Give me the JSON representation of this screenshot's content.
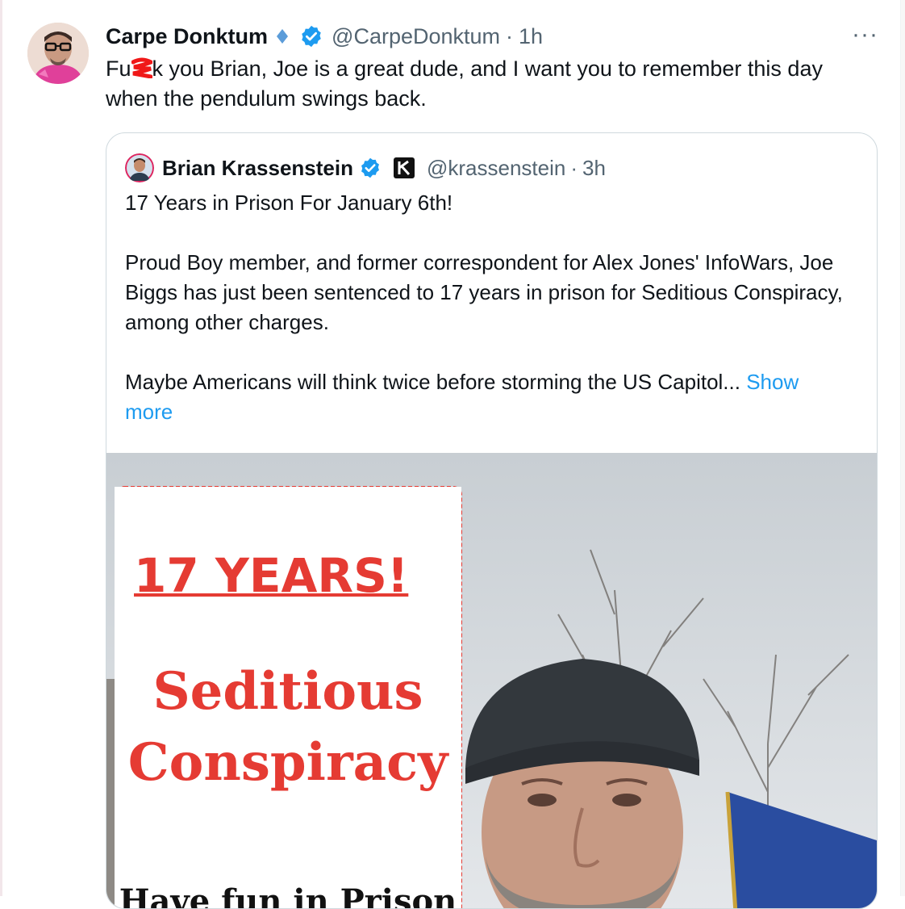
{
  "tweet": {
    "display_name": "Carpe Donktum",
    "handle": "@CarpeDonktum",
    "separator": "·",
    "time": "1h",
    "more_label": "···",
    "text_prefix": "Fu",
    "text_after_redaction": "k you Brian, Joe is a great dude, and I want you to remember this day when the pendulum swings back."
  },
  "quote": {
    "display_name": "Brian Krassenstein",
    "handle": "@krassenstein",
    "separator": "·",
    "time": "3h",
    "paragraph_1": "17 Years in Prison For January 6th!",
    "paragraph_2": "Proud Boy member, and former correspondent for Alex Jones' InfoWars, Joe Biggs has just been sentenced to 17 years in prison for Seditious Conspiracy, among other charges.",
    "paragraph_3": "Maybe Americans will think twice before storming the US Capitol...",
    "show_more": "Show more"
  },
  "media": {
    "sign_line_1": "17 YEARS!",
    "sign_line_2": "Seditious",
    "sign_line_3": "Conspiracy",
    "sign_line_4": "Have fun in Prison"
  },
  "colors": {
    "accent": "#1d9bf0",
    "sign_red": "#e53b33",
    "muted_text": "#536471"
  }
}
